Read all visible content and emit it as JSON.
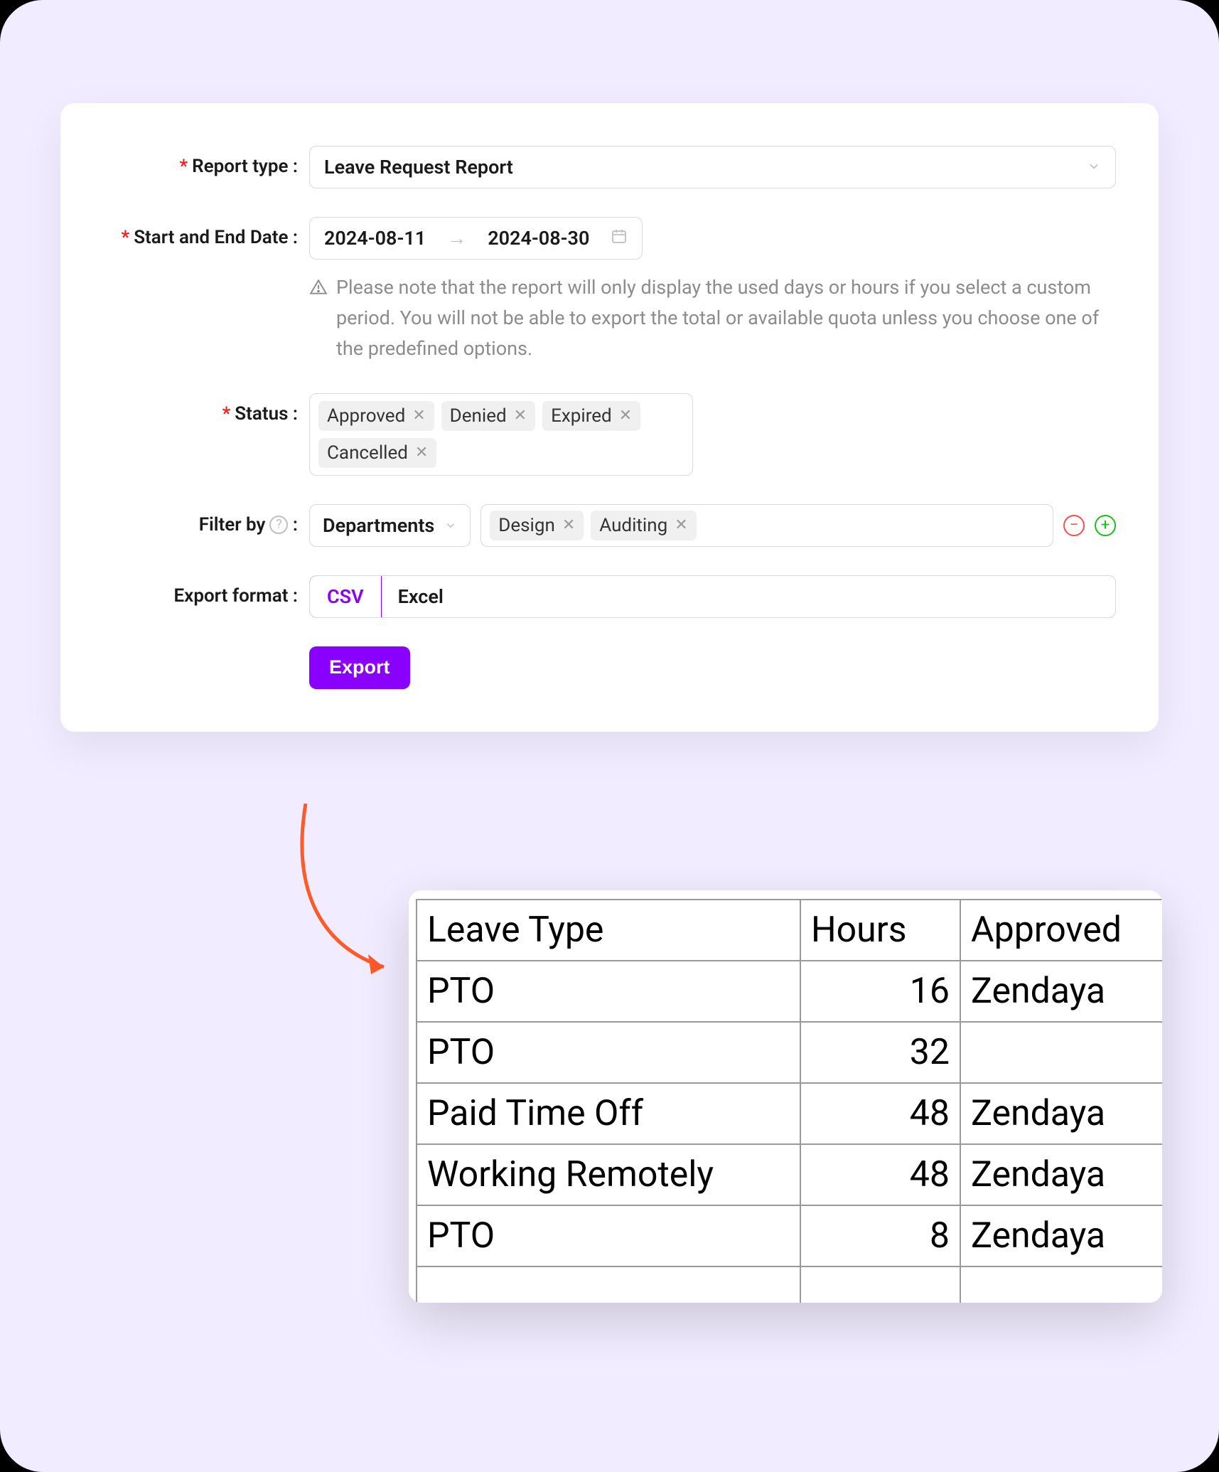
{
  "form": {
    "report_type": {
      "label": "Report type",
      "value": "Leave Request Report"
    },
    "date_range": {
      "label": "Start and End Date",
      "start": "2024-08-11",
      "end": "2024-08-30",
      "helper": "Please note that the report will only display the used days or hours if you select a custom period. You will not be able to export the total or available quota unless you choose one of the predefined options."
    },
    "status": {
      "label": "Status",
      "tags": [
        "Approved",
        "Denied",
        "Expired",
        "Cancelled"
      ]
    },
    "filter_by": {
      "label": "Filter by",
      "selector": "Departments",
      "tags": [
        "Design",
        "Auditing"
      ]
    },
    "export_format": {
      "label": "Export format",
      "options": [
        "CSV",
        "Excel"
      ],
      "selected": "CSV"
    },
    "export_button": "Export"
  },
  "report_table": {
    "headers": [
      "Leave Type",
      "Hours",
      "Approved"
    ],
    "rows": [
      {
        "type": "PTO",
        "hours": 16,
        "approved": "Zendaya"
      },
      {
        "type": "PTO",
        "hours": 32,
        "approved": ""
      },
      {
        "type": "Paid Time Off",
        "hours": 48,
        "approved": "Zendaya"
      },
      {
        "type": "Working Remotely",
        "hours": 48,
        "approved": "Zendaya"
      },
      {
        "type": "PTO",
        "hours": 8,
        "approved": "Zendaya"
      }
    ]
  }
}
